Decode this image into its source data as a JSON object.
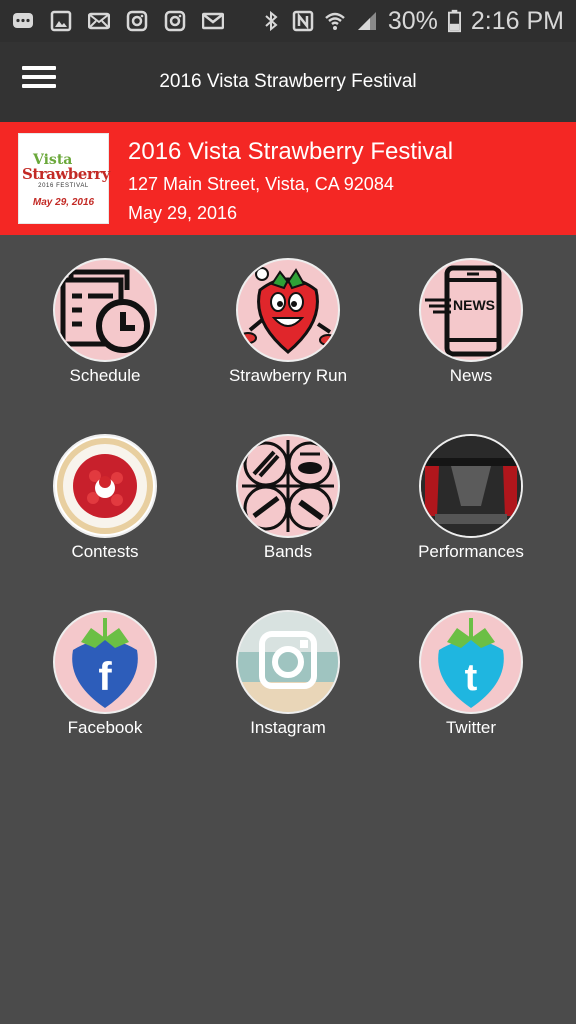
{
  "status_bar": {
    "battery": "30%",
    "time": "2:16 PM"
  },
  "app_bar": {
    "title": "2016 Vista Strawberry Festival"
  },
  "event": {
    "name": "2016 Vista Strawberry Festival",
    "address": "127 Main Street, Vista, CA 92084",
    "date": "May 29, 2016",
    "logo": {
      "line1": "Vista",
      "line2": "Strawberry",
      "line3": "2016 FESTIVAL",
      "line4": "May 29, 2016"
    }
  },
  "tiles": [
    {
      "label": "Schedule",
      "icon": "schedule-icon"
    },
    {
      "label": "Strawberry Run",
      "icon": "strawberry-mascot-icon"
    },
    {
      "label": "News",
      "icon": "news-phone-icon",
      "icon_text": "NEWS"
    },
    {
      "label": "Contests",
      "icon": "strawberry-pie-icon"
    },
    {
      "label": "Bands",
      "icon": "instruments-icon"
    },
    {
      "label": "Performances",
      "icon": "stage-icon"
    },
    {
      "label": "Facebook",
      "icon": "facebook-strawberry-icon",
      "icon_text": "f"
    },
    {
      "label": "Instagram",
      "icon": "instagram-icon"
    },
    {
      "label": "Twitter",
      "icon": "twitter-strawberry-icon",
      "icon_text": "t"
    }
  ],
  "colors": {
    "banner": "#f42724",
    "background": "#4b4b4b",
    "app_bar": "#333333",
    "status_bar": "#2f2f2f",
    "icon_circle": "#f4c8cb"
  }
}
